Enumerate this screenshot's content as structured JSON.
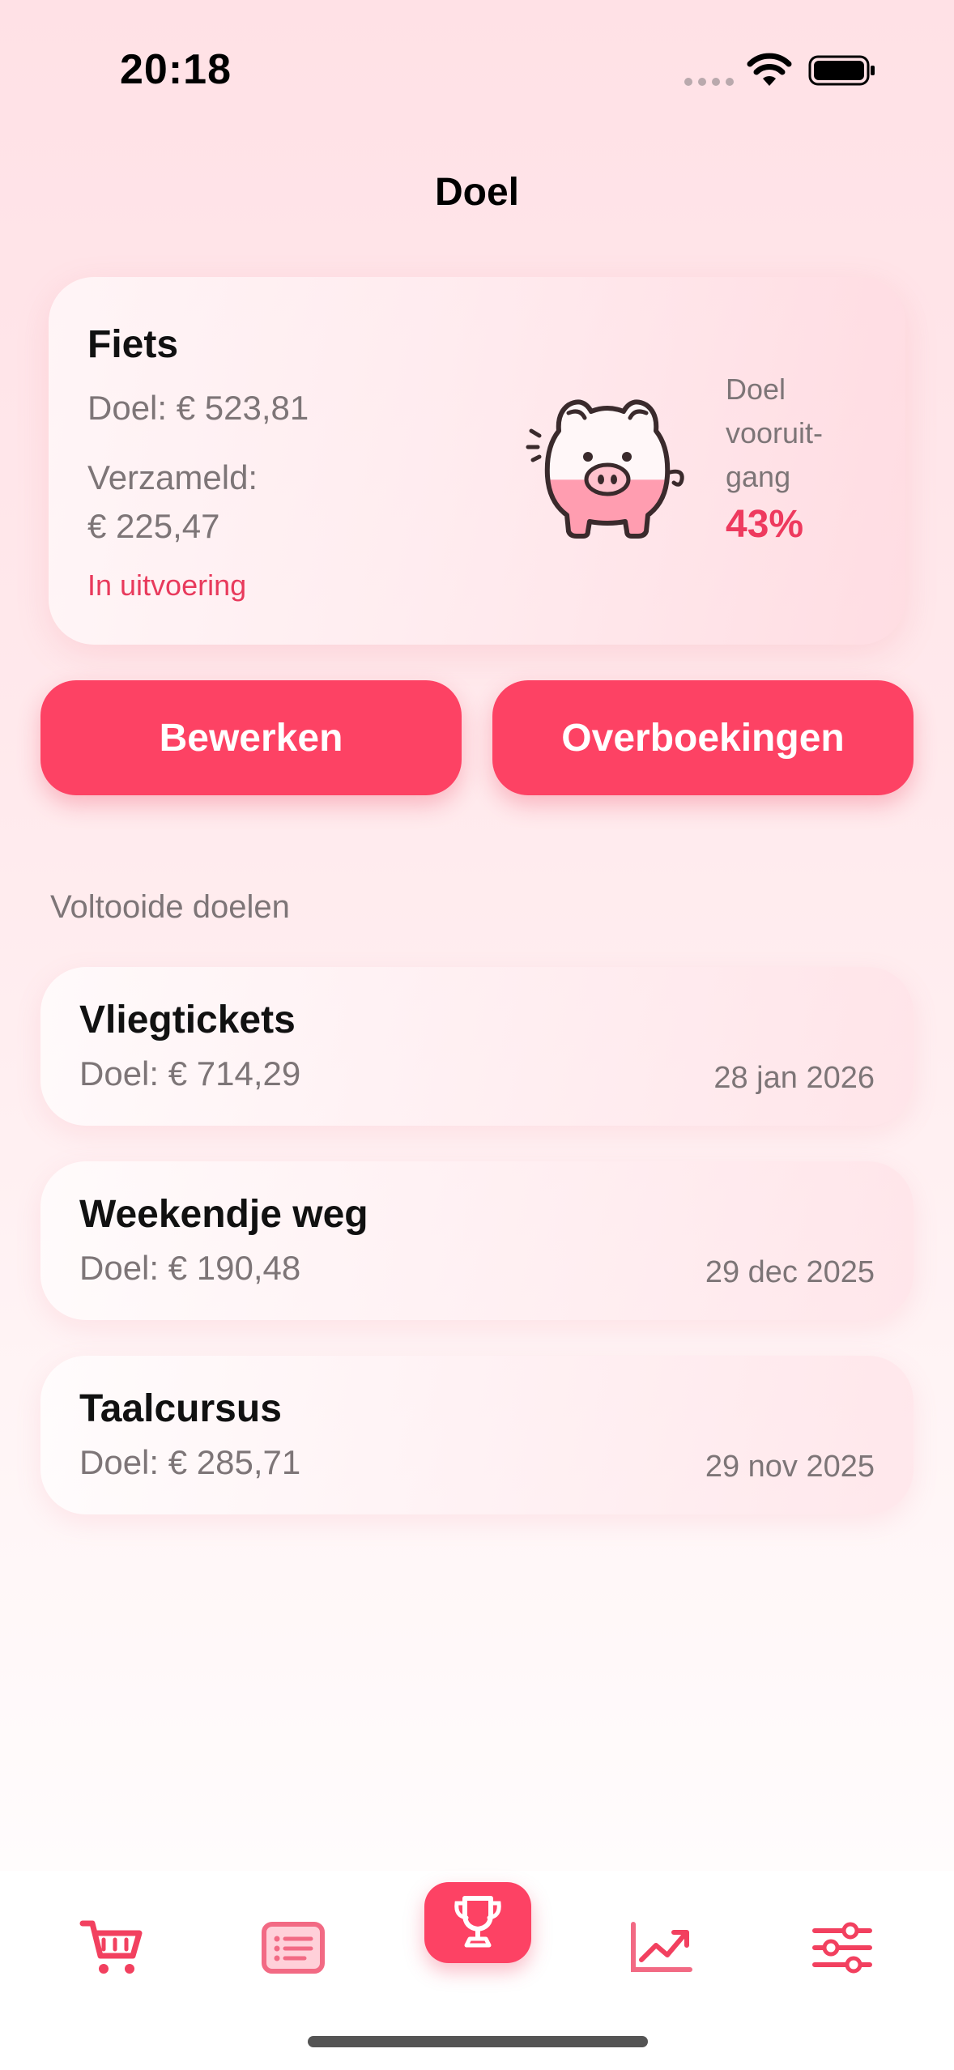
{
  "status_bar": {
    "time": "20:18"
  },
  "header": {
    "title": "Doel"
  },
  "current_goal": {
    "name": "Fiets",
    "target": "Doel: € 523,81",
    "collected_label": "Verzameld:",
    "collected_value": "€ 225,47",
    "status": "In uitvoering",
    "progress_label_1": "Doel",
    "progress_label_2": "vooruit-",
    "progress_label_3": "gang",
    "progress_value": "43%",
    "progress_fraction": 0.43,
    "icon": "piggy-bank-icon"
  },
  "actions": {
    "edit_label": "Bewerken",
    "transfers_label": "Overboekingen"
  },
  "completed": {
    "section_label": "Voltooide doelen",
    "items": [
      {
        "name": "Vliegtickets",
        "target": "Doel: € 714,29",
        "date": "28 jan 2026"
      },
      {
        "name": "Weekendje weg",
        "target": "Doel: € 190,48",
        "date": "29 dec 2025"
      },
      {
        "name": "Taalcursus",
        "target": "Doel: € 285,71",
        "date": "29 nov 2025"
      }
    ]
  },
  "tab_bar": {
    "tabs": [
      {
        "icon": "cart-icon",
        "active": false
      },
      {
        "icon": "list-icon",
        "active": false
      },
      {
        "icon": "trophy-icon",
        "active": true
      },
      {
        "icon": "chart-icon",
        "active": false
      },
      {
        "icon": "sliders-icon",
        "active": false
      }
    ]
  },
  "colors": {
    "accent": "#fd4264",
    "status_text": "#e83a5c",
    "secondary_text": "#7d7577"
  }
}
